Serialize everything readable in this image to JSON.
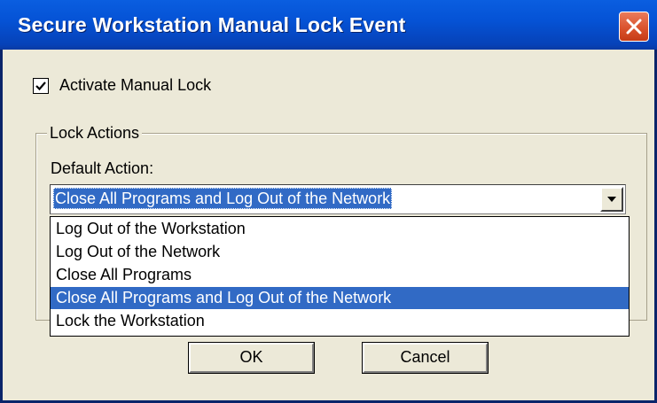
{
  "window": {
    "title": "Secure Workstation Manual Lock Event"
  },
  "checkbox": {
    "label": "Activate Manual Lock",
    "checked": true
  },
  "group": {
    "title": "Lock Actions",
    "default_label": "Default Action:"
  },
  "combo": {
    "value": "Close All Programs and Log Out of the Network",
    "options": [
      "Log Out of the Workstation",
      "Log Out of the Network",
      "Close All Programs",
      "Close All Programs and Log Out of the Network",
      "Lock the Workstation"
    ],
    "selected_index": 3
  },
  "buttons": {
    "ok": "OK",
    "cancel": "Cancel"
  },
  "colors": {
    "title_bar": "#0553d6",
    "highlight": "#316ac5",
    "dialog_bg": "#ece9d8",
    "close_button": "#d9502a"
  },
  "icons": [
    "close-icon",
    "checkmark-icon",
    "dropdown-arrow-icon"
  ]
}
